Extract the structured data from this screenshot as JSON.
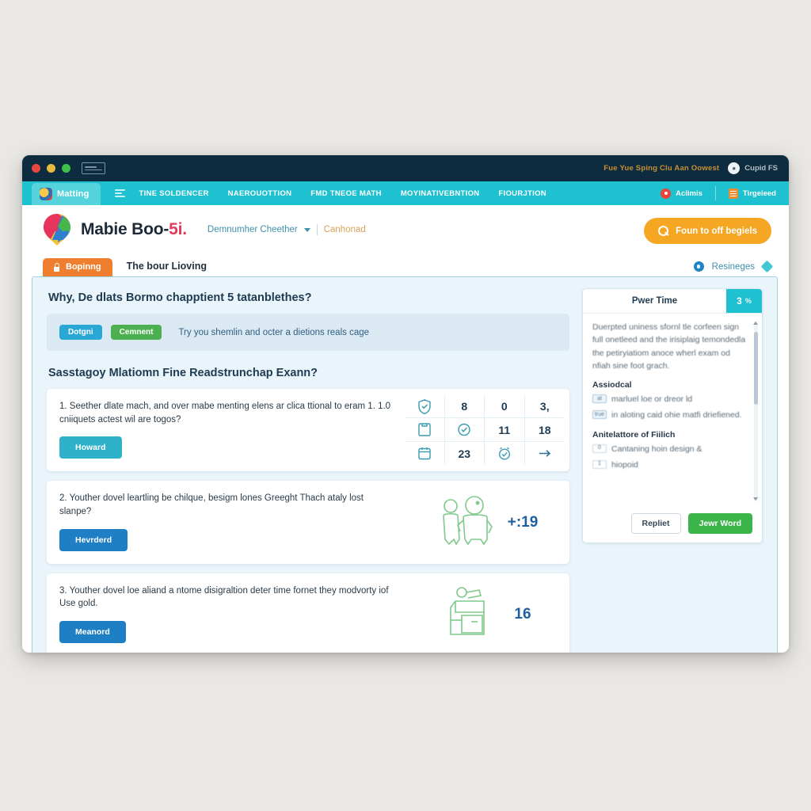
{
  "titlebar": {
    "note": "Fue Yue Sping Clu Aan Oowest",
    "user": "Cupid FS",
    "avatar_icon": "user-avatar-icon"
  },
  "navbar": {
    "brand": "Matting",
    "brand_logo_icon": "brand-logo-icon",
    "menu_icon": "hamburger-menu-icon",
    "links": [
      "TINE SOLDENCER",
      "NAEROUOTTION",
      "FMD TNEOE MATH",
      "MOYINATIVEBNTION",
      "FIOURJTION"
    ],
    "right_items": [
      {
        "label": "Aclimis",
        "icon": "alert-circle-icon"
      },
      {
        "label": "Tirgeieed",
        "icon": "document-icon"
      }
    ]
  },
  "header": {
    "logo_icon": "location-pin-logo-icon",
    "brand_main": "Mabie Boo-",
    "brand_accent": "5i.",
    "breadcrumb": "Demnumher Cheether",
    "breadcrumb_caret_icon": "chevron-down-icon",
    "breadcrumb_alt": "Canhonad",
    "cta_label": "Foun to off begiels",
    "cta_icon": "search-icon"
  },
  "tabstrip": {
    "active_tab": "Bopinng",
    "lock_icon": "lock-icon",
    "static_label": "The bour Lioving",
    "settings_label": "Resineges",
    "gear_icon": "gear-icon",
    "diamond_icon": "diamond-icon"
  },
  "content": {
    "heading": "Why, De dlats Bormo chapptient 5 tatanblethes?",
    "actionbar": {
      "pill_primary": "Dotgni",
      "pill_secondary": "Cemnent",
      "note": "Try you shemlin and octer a dietions reals cage"
    },
    "section_title": "Sasstagoy Mlatiomn Fine Readstrunchap Exann?",
    "cards": [
      {
        "text": "1. Seether dlate mach, and over mabe menting elens ar clica ttional to eram 1. 1.0 cniiquets actest wil are togos?",
        "button": "Howard",
        "button_style": "teal",
        "grid": [
          {
            "type": "icon",
            "name": "shield-check-icon"
          },
          {
            "type": "number",
            "value": "8"
          },
          {
            "type": "number",
            "value": "0"
          },
          {
            "type": "number",
            "value": "3,"
          },
          {
            "type": "icon",
            "name": "clipboard-icon"
          },
          {
            "type": "icon",
            "name": "check-circle-icon"
          },
          {
            "type": "number",
            "value": "11"
          },
          {
            "type": "number",
            "value": "18"
          },
          {
            "type": "icon",
            "name": "calendar-icon"
          },
          {
            "type": "number",
            "value": "23"
          },
          {
            "type": "icon",
            "name": "alarm-check-icon"
          },
          {
            "type": "icon",
            "name": "arrow-right-icon"
          }
        ]
      },
      {
        "text": "2. Youther dovel leartling be chilque, besigm lones Greeght Thach ataly lost slanpe?",
        "button": "Hevrderd",
        "button_style": "blue",
        "illustration": "two-people-icon",
        "number": "+:19"
      },
      {
        "text": "3. Youther dovel loe aliand a ntome disigraltion deter time fornet they modvorty iof Use gold.",
        "button": "Meanord",
        "button_style": "blue",
        "illustration": "desk-setup-icon",
        "number": "16"
      }
    ]
  },
  "sidepanel": {
    "title": "Pwer Time",
    "badge_count": "3",
    "badge_suffix": "%",
    "paragraph": "Duerpted uniness sfornl tle corfeen sign full onetleed and the irisiplaig temondedla the petiryiatiom anoce wherl exam od nfiah sine foot grach.",
    "sub1": "Assiodcal",
    "rows1": [
      {
        "chip": "at",
        "text": "marluel loe or dreor ld"
      },
      {
        "chip": "true",
        "text": "in aloting caid ohie matfi driefiened."
      }
    ],
    "sub2": "Anitelattore of Fiilich",
    "rows2": [
      {
        "chip": "0",
        "text": "Cantaning hoin design &"
      },
      {
        "chip": "1",
        "text": "hiopoid"
      }
    ],
    "btn_secondary": "Repliet",
    "btn_primary": "Jewr Word",
    "scrollbar_icon": "vertical-scrollbar"
  },
  "colors": {
    "nav_teal": "#1ec1cf",
    "titlebar_navy": "#0d2c40",
    "cta_orange": "#f5a623",
    "tab_orange": "#ef7f2e",
    "panel_blue": "#e9f4fb",
    "accent_red": "#e23b5a",
    "green": "#3bb54a",
    "button_blue": "#1f7fc4"
  }
}
